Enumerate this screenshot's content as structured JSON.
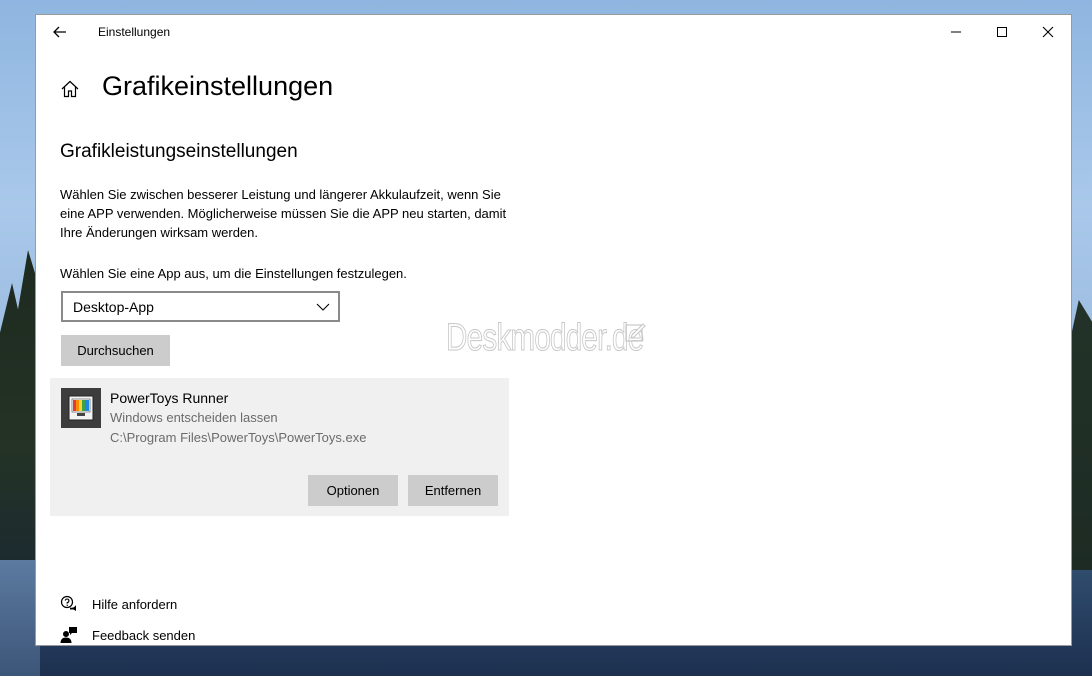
{
  "window": {
    "title": "Einstellungen"
  },
  "page": {
    "title": "Grafikeinstellungen",
    "section_title": "Grafikleistungseinstellungen",
    "description": "Wählen Sie zwischen besserer Leistung und längerer Akkulaufzeit, wenn Sie eine APP verwenden. Möglicherweise müssen Sie die APP neu starten, damit Ihre Änderungen wirksam werden.",
    "choose_label": "Wählen Sie eine App aus, um die Einstellungen festzulegen.",
    "dropdown_value": "Desktop-App",
    "browse_label": "Durchsuchen"
  },
  "watermark": {
    "text": "Deskmodder.de"
  },
  "app_card": {
    "name": "PowerToys Runner",
    "preference": "Windows entscheiden lassen",
    "path": "C:\\Program Files\\PowerToys\\PowerToys.exe",
    "options_label": "Optionen",
    "remove_label": "Entfernen"
  },
  "footer": {
    "help_label": "Hilfe anfordern",
    "feedback_label": "Feedback senden"
  },
  "icons": {
    "back": "back-arrow-icon",
    "minimize": "minimize-icon",
    "maximize": "maximize-icon",
    "close": "close-icon",
    "home": "home-icon",
    "dropdown": "chevron-down-icon",
    "app": "powertoys-icon",
    "help": "help-chat-icon",
    "feedback": "feedback-person-icon"
  }
}
